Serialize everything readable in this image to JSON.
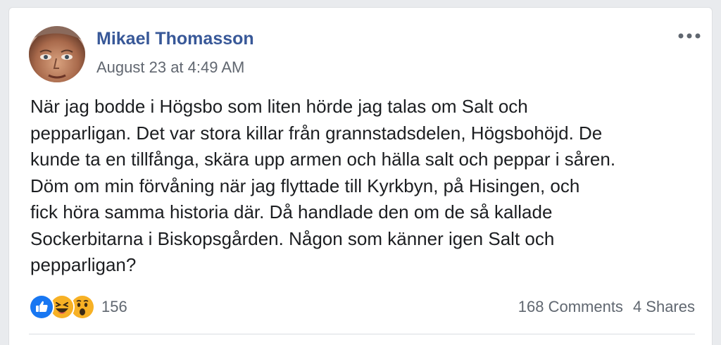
{
  "post": {
    "author": "Mikael Thomasson",
    "timestamp": "August 23 at 4:49 AM",
    "more_icon": "more-horizontal-icon",
    "body": "När jag bodde i Högsbo som liten hörde jag talas om Salt och\npepparligan. Det var stora killar från grannstadsdelen, Högsbohöjd. De\nkunde ta en tillfånga, skära upp armen och hälla salt och peppar i såren.\nDöm om min förvåning när jag flyttade till Kyrkbyn, på Hisingen, och\nfick höra samma historia där. Då handlade den om de så kallade\nSockerbitarna i Biskopsgården. Någon som känner igen Salt och\npepparligan?"
  },
  "reactions": {
    "icons": [
      "like-reaction-icon",
      "haha-reaction-icon",
      "wow-reaction-icon"
    ],
    "count": "156"
  },
  "stats": {
    "comments": "168 Comments",
    "shares": "4 Shares"
  },
  "colors": {
    "author": "#385898",
    "like": "#1877f2",
    "emoji": "#f7b125"
  }
}
